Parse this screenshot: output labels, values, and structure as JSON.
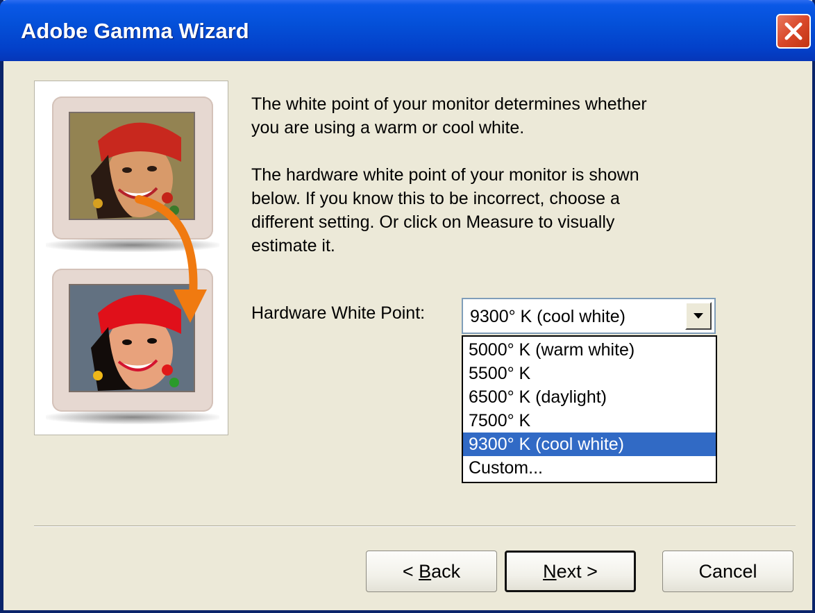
{
  "window": {
    "title": "Adobe Gamma Wizard"
  },
  "illustration": {
    "description_icon": "monitor-before-after-icon"
  },
  "text": {
    "paragraph1_line1": "The white point of your monitor determines whether",
    "paragraph1_line2": "you are using a warm or cool white.",
    "paragraph2_line1": "The hardware white point of your monitor is shown",
    "paragraph2_line2": "below. If you know this to be incorrect, choose a",
    "paragraph2_line3": "different setting. Or click on Measure to visually",
    "paragraph2_line4": "estimate it."
  },
  "white_point": {
    "label": "Hardware White Point:",
    "selected": "9300° K (cool white)",
    "options": [
      "5000° K (warm white)",
      "5500° K",
      "6500° K (daylight)",
      "7500° K",
      "9300° K (cool white)",
      "Custom..."
    ],
    "selected_index": 4
  },
  "buttons": {
    "back_prefix": "< ",
    "back_hotkey": "B",
    "back_rest": "ack",
    "next_hotkey": "N",
    "next_rest": "ext >",
    "cancel": "Cancel"
  },
  "colors": {
    "titlebar": "#0450d8",
    "selection": "#316ac5",
    "close": "#d9482a"
  }
}
